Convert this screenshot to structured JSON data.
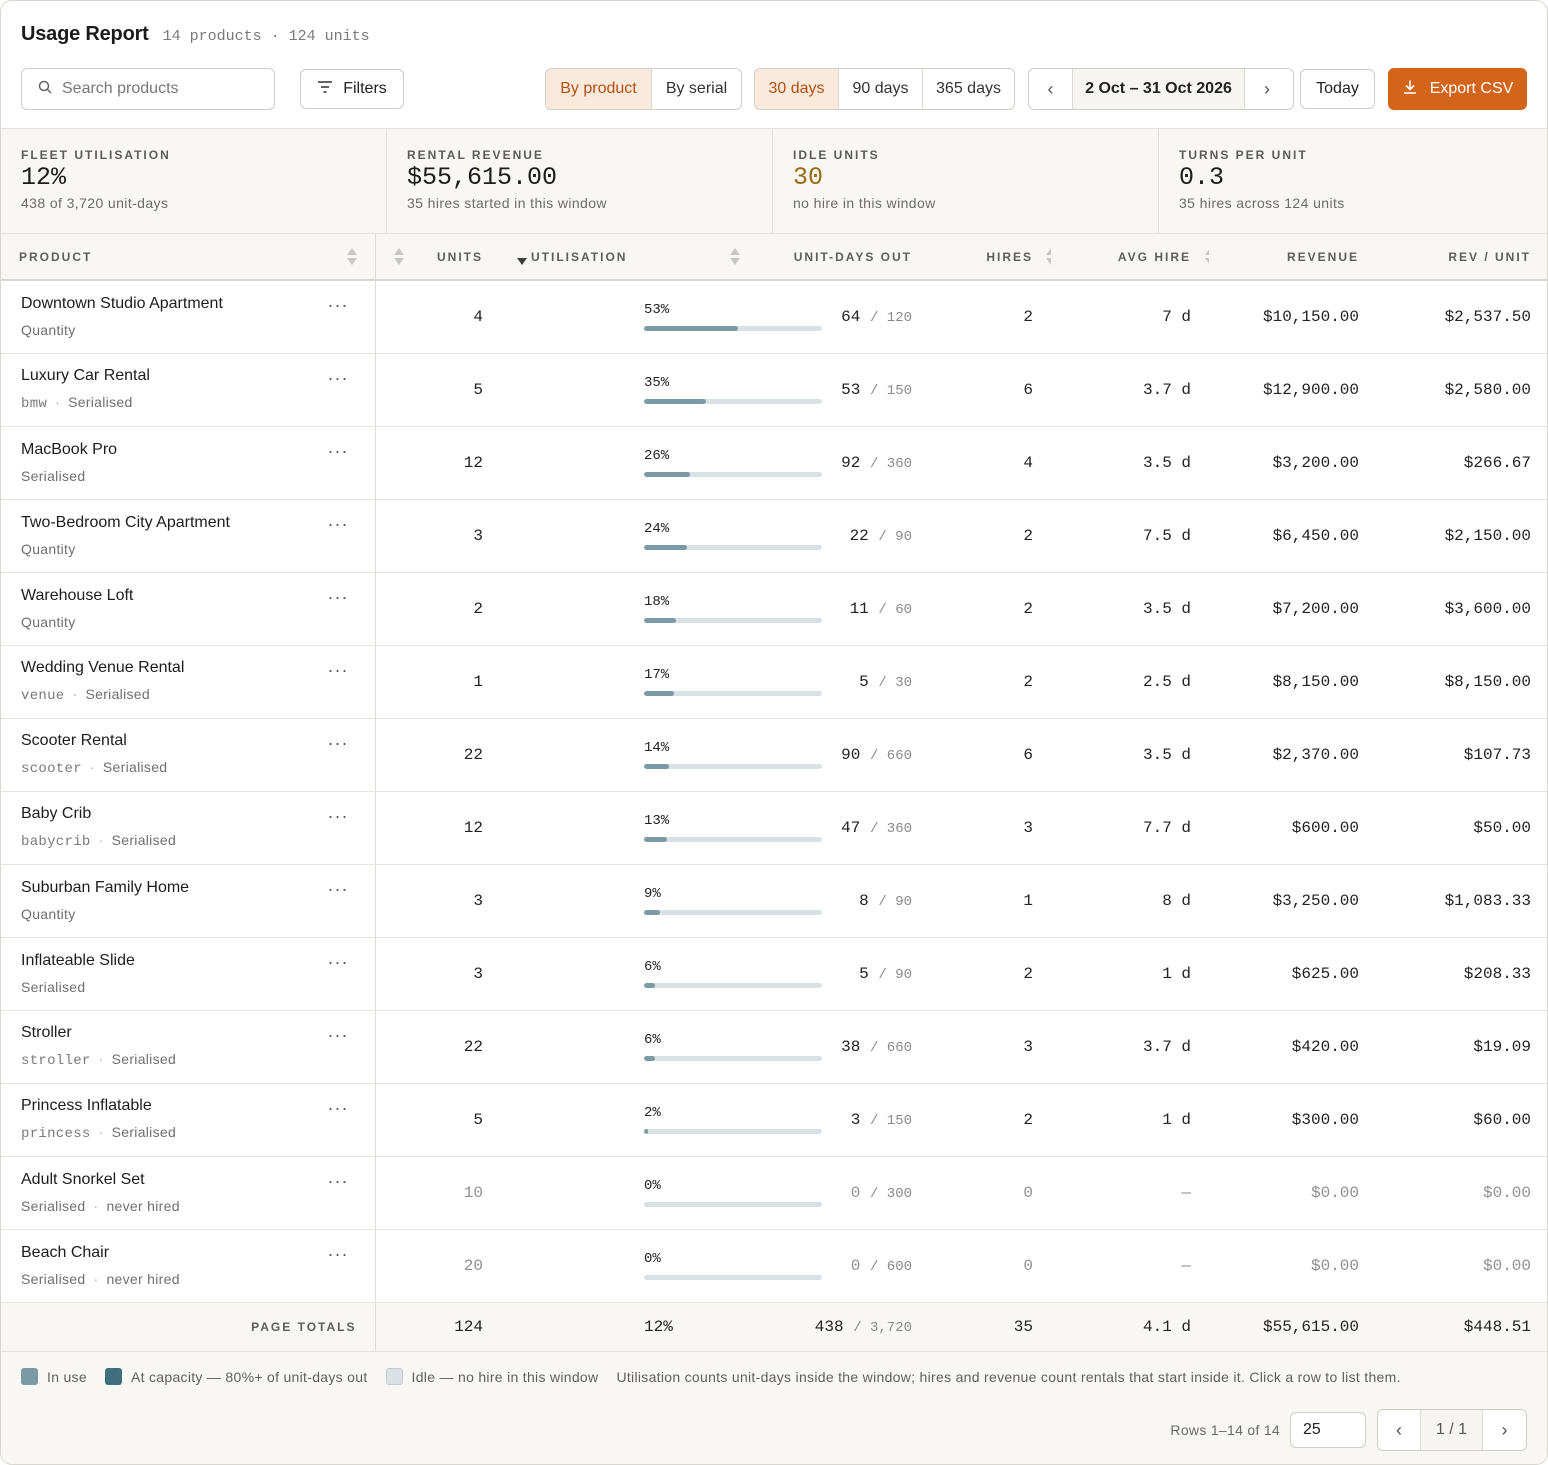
{
  "header": {
    "title": "Usage Report",
    "subtitle": "14 products · 124 units"
  },
  "toolbar": {
    "search_placeholder": "Search products",
    "filters_label": "Filters",
    "view_options": [
      "By product",
      "By serial"
    ],
    "view_selected": "By product",
    "range_options": [
      "30 days",
      "90 days",
      "365 days"
    ],
    "range_selected": "30 days",
    "prev_label": "‹",
    "next_label": "›",
    "date_range": "2 Oct – 31 Oct 2026",
    "today_label": "Today",
    "export_label": "Export CSV",
    "accent_color": "#d3651a"
  },
  "stats": [
    {
      "label": "FLEET UTILISATION",
      "value": "12%",
      "sub": "438 of 3,720 unit-days",
      "tone": "normal"
    },
    {
      "label": "RENTAL REVENUE",
      "value": "$55,615.00",
      "sub": "35 hires started in this window",
      "tone": "normal"
    },
    {
      "label": "IDLE UNITS",
      "value": "30",
      "sub": "no hire in this window",
      "tone": "warn"
    },
    {
      "label": "TURNS PER UNIT",
      "value": "0.3",
      "sub": "35 hires across 124 units",
      "tone": "normal"
    }
  ],
  "table": {
    "columns": [
      "PRODUCT",
      "UNITS",
      "UTILISATION",
      "UNIT-DAYS OUT",
      "HIRES",
      "AVG HIRE",
      "REVENUE",
      "REV / UNIT"
    ],
    "sorted_column": "UTILISATION",
    "sort_direction": "desc",
    "more_glyph": "···",
    "rows": [
      {
        "name": "Downtown Studio Apartment",
        "slug": "",
        "meta": [
          "Quantity"
        ],
        "units": "4",
        "util": "53%",
        "util_value": 53,
        "days_out": "64",
        "days_total": "/ 120",
        "hires": "2",
        "avg": "7 d",
        "revenue": "$10,150.00",
        "rev_unit": "$2,537.50",
        "idle": false
      },
      {
        "name": "Luxury Car Rental",
        "slug": "bmw",
        "meta": [
          "Serialised"
        ],
        "units": "5",
        "util": "35%",
        "util_value": 35,
        "days_out": "53",
        "days_total": "/ 150",
        "hires": "6",
        "avg": "3.7 d",
        "revenue": "$12,900.00",
        "rev_unit": "$2,580.00",
        "idle": false
      },
      {
        "name": "MacBook Pro",
        "slug": "",
        "meta": [
          "Serialised"
        ],
        "units": "12",
        "util": "26%",
        "util_value": 26,
        "days_out": "92",
        "days_total": "/ 360",
        "hires": "4",
        "avg": "3.5 d",
        "revenue": "$3,200.00",
        "rev_unit": "$266.67",
        "idle": false
      },
      {
        "name": "Two-Bedroom City Apartment",
        "slug": "",
        "meta": [
          "Quantity"
        ],
        "units": "3",
        "util": "24%",
        "util_value": 24,
        "days_out": "22",
        "days_total": "/ 90",
        "hires": "2",
        "avg": "7.5 d",
        "revenue": "$6,450.00",
        "rev_unit": "$2,150.00",
        "idle": false
      },
      {
        "name": "Warehouse Loft",
        "slug": "",
        "meta": [
          "Quantity"
        ],
        "units": "2",
        "util": "18%",
        "util_value": 18,
        "days_out": "11",
        "days_total": "/ 60",
        "hires": "2",
        "avg": "3.5 d",
        "revenue": "$7,200.00",
        "rev_unit": "$3,600.00",
        "idle": false
      },
      {
        "name": "Wedding Venue Rental",
        "slug": "venue",
        "meta": [
          "Serialised"
        ],
        "units": "1",
        "util": "17%",
        "util_value": 17,
        "days_out": "5",
        "days_total": "/ 30",
        "hires": "2",
        "avg": "2.5 d",
        "revenue": "$8,150.00",
        "rev_unit": "$8,150.00",
        "idle": false
      },
      {
        "name": "Scooter Rental",
        "slug": "scooter",
        "meta": [
          "Serialised"
        ],
        "units": "22",
        "util": "14%",
        "util_value": 14,
        "days_out": "90",
        "days_total": "/ 660",
        "hires": "6",
        "avg": "3.5 d",
        "revenue": "$2,370.00",
        "rev_unit": "$107.73",
        "idle": false
      },
      {
        "name": "Baby Crib",
        "slug": "babycrib",
        "meta": [
          "Serialised"
        ],
        "units": "12",
        "util": "13%",
        "util_value": 13,
        "days_out": "47",
        "days_total": "/ 360",
        "hires": "3",
        "avg": "7.7 d",
        "revenue": "$600.00",
        "rev_unit": "$50.00",
        "idle": false
      },
      {
        "name": "Suburban Family Home",
        "slug": "",
        "meta": [
          "Quantity"
        ],
        "units": "3",
        "util": "9%",
        "util_value": 9,
        "days_out": "8",
        "days_total": "/ 90",
        "hires": "1",
        "avg": "8 d",
        "revenue": "$3,250.00",
        "rev_unit": "$1,083.33",
        "idle": false
      },
      {
        "name": "Inflateable Slide",
        "slug": "",
        "meta": [
          "Serialised"
        ],
        "units": "3",
        "util": "6%",
        "util_value": 6,
        "days_out": "5",
        "days_total": "/ 90",
        "hires": "2",
        "avg": "1 d",
        "revenue": "$625.00",
        "rev_unit": "$208.33",
        "idle": false
      },
      {
        "name": "Stroller",
        "slug": "stroller",
        "meta": [
          "Serialised"
        ],
        "units": "22",
        "util": "6%",
        "util_value": 6,
        "days_out": "38",
        "days_total": "/ 660",
        "hires": "3",
        "avg": "3.7 d",
        "revenue": "$420.00",
        "rev_unit": "$19.09",
        "idle": false
      },
      {
        "name": "Princess Inflatable",
        "slug": "princess",
        "meta": [
          "Serialised"
        ],
        "units": "5",
        "util": "2%",
        "util_value": 2,
        "days_out": "3",
        "days_total": "/ 150",
        "hires": "2",
        "avg": "1 d",
        "revenue": "$300.00",
        "rev_unit": "$60.00",
        "idle": false
      },
      {
        "name": "Adult Snorkel Set",
        "slug": "",
        "meta": [
          "Serialised",
          "never hired"
        ],
        "units": "10",
        "util": "0%",
        "util_value": 0,
        "days_out": "0",
        "days_total": "/ 300",
        "hires": "0",
        "avg": "—",
        "revenue": "$0.00",
        "rev_unit": "$0.00",
        "idle": true
      },
      {
        "name": "Beach Chair",
        "slug": "",
        "meta": [
          "Serialised",
          "never hired"
        ],
        "units": "20",
        "util": "0%",
        "util_value": 0,
        "days_out": "0",
        "days_total": "/ 600",
        "hires": "0",
        "avg": "—",
        "revenue": "$0.00",
        "rev_unit": "$0.00",
        "idle": true
      }
    ],
    "totals": {
      "label": "PAGE TOTALS",
      "units": "124",
      "util": "12%",
      "days_out": "438",
      "days_total": "/ 3,720",
      "hires": "35",
      "avg": "4.1 d",
      "revenue": "$55,615.00",
      "rev_unit": "$448.51"
    }
  },
  "legend": {
    "items": [
      {
        "label": "In use",
        "color": "#7a9aa6"
      },
      {
        "label": "At capacity — 80%+ of unit-days out",
        "color": "#3f6f7c"
      },
      {
        "label": "Idle — no hire in this window",
        "color": "#d9e1e4"
      }
    ],
    "note": "Utilisation counts unit-days inside the window; hires and revenue count rentals that start inside it. Click a row to list them."
  },
  "pagination": {
    "rows_label": "Rows 1–14 of 14",
    "page_size": "25",
    "page_label": "1 / 1",
    "prev": "‹",
    "next": "›"
  }
}
